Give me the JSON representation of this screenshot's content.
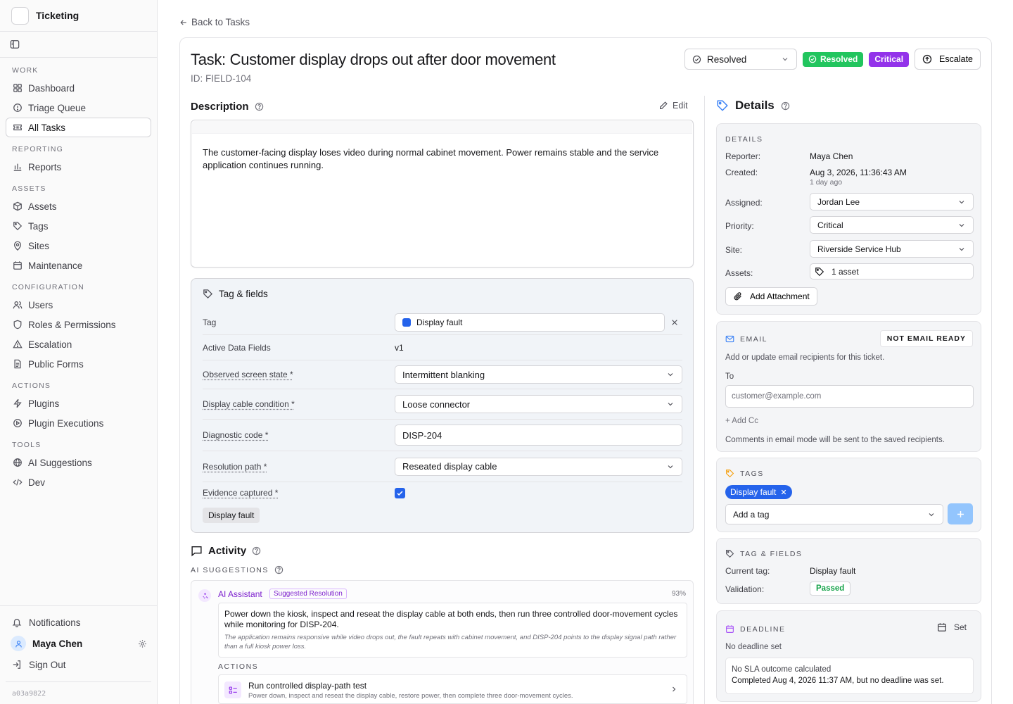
{
  "app": {
    "name": "Ticketing",
    "build": "a03a9822"
  },
  "sidebar": {
    "sections": [
      {
        "label": "WORK",
        "items": [
          {
            "label": "Dashboard",
            "icon": "grid-icon"
          },
          {
            "label": "Triage Queue",
            "icon": "alert-circle-icon"
          },
          {
            "label": "All Tasks",
            "icon": "ticket-icon",
            "active": true
          }
        ]
      },
      {
        "label": "REPORTING",
        "items": [
          {
            "label": "Reports",
            "icon": "bar-chart-icon"
          }
        ]
      },
      {
        "label": "ASSETS",
        "items": [
          {
            "label": "Assets",
            "icon": "box-icon"
          },
          {
            "label": "Tags",
            "icon": "tag-icon"
          },
          {
            "label": "Sites",
            "icon": "map-pin-icon"
          },
          {
            "label": "Maintenance",
            "icon": "calendar-icon"
          }
        ]
      },
      {
        "label": "CONFIGURATION",
        "items": [
          {
            "label": "Users",
            "icon": "users-icon"
          },
          {
            "label": "Roles & Permissions",
            "icon": "shield-icon"
          },
          {
            "label": "Escalation",
            "icon": "warning-triangle-icon"
          },
          {
            "label": "Public Forms",
            "icon": "file-text-icon"
          }
        ]
      },
      {
        "label": "ACTIONS",
        "items": [
          {
            "label": "Plugins",
            "icon": "zap-icon"
          },
          {
            "label": "Plugin Executions",
            "icon": "play-circle-icon"
          }
        ]
      },
      {
        "label": "TOOLS",
        "items": [
          {
            "label": "AI Suggestions",
            "icon": "globe-icon"
          },
          {
            "label": "Dev",
            "icon": "code-icon"
          }
        ]
      }
    ],
    "notifications": "Notifications",
    "user_name": "Maya Chen",
    "sign_out": "Sign Out"
  },
  "header": {
    "back": "Back to Tasks",
    "title": "Task: Customer display drops out after door movement",
    "id": "ID: FIELD-104",
    "status_value": "Resolved",
    "badge_status": "Resolved",
    "badge_priority": "Critical",
    "escalate": "Escalate",
    "colors": {
      "resolved": "#22c55e",
      "critical": "#9333ea"
    }
  },
  "description": {
    "title": "Description",
    "edit": "Edit",
    "text": "The customer-facing display loses video during normal cabinet movement. Power remains stable and the service application continues running."
  },
  "tag_fields": {
    "title": "Tag & fields",
    "tag_label": "Tag",
    "tag_value": "Display fault",
    "active_label": "Active Data Fields",
    "active_value": "v1",
    "fields": [
      {
        "label": "Observed screen state *",
        "value": "Intermittent blanking",
        "type": "select"
      },
      {
        "label": "Display cable condition *",
        "value": "Loose connector",
        "type": "select"
      },
      {
        "label": "Diagnostic code *",
        "value": "DISP-204",
        "type": "text"
      },
      {
        "label": "Resolution path *",
        "value": "Reseated display cable",
        "type": "select"
      }
    ],
    "evidence_label": "Evidence captured *",
    "evidence_checked": true,
    "chip": "Display fault"
  },
  "activity": {
    "title": "Activity",
    "ai_label": "AI SUGGESTIONS",
    "assistant": "AI Assistant",
    "badge": "Suggested Resolution",
    "confidence": "93%",
    "suggestion": "Power down the kiosk, inspect and reseat the display cable at both ends, then run three controlled door-movement cycles while monitoring for DISP-204.",
    "reason": "The application remains responsive while video drops out, the fault repeats with cabinet movement, and DISP-204 points to the display signal path rather than a full kiosk power loss.",
    "actions_label": "ACTIONS",
    "action_title": "Run controlled display-path test",
    "action_desc": "Power down, inspect and reseat the display cable, restore power, then complete three door-movement cycles."
  },
  "details": {
    "title": "Details",
    "section_label": "DETAILS",
    "reporter_k": "Reporter:",
    "reporter_v": "Maya Chen",
    "created_k": "Created:",
    "created_v": "Aug 3, 2026, 11:36:43 AM",
    "created_sub": "1 day ago",
    "assigned_k": "Assigned:",
    "assigned_v": "Jordan Lee",
    "priority_k": "Priority:",
    "priority_v": "Critical",
    "site_k": "Site:",
    "site_v": "Riverside Service Hub",
    "assets_k": "Assets:",
    "assets_v": "1 asset",
    "attach": "Add Attachment"
  },
  "email": {
    "label": "EMAIL",
    "status": "NOT EMAIL READY",
    "help": "Add or update email recipients for this ticket.",
    "to_label": "To",
    "placeholder": "customer@example.com",
    "add_cc": "+ Add Cc",
    "note": "Comments in email mode will be sent to the saved recipients."
  },
  "tags": {
    "label": "TAGS",
    "chip": "Display fault",
    "add_placeholder": "Add a tag"
  },
  "tag_summary": {
    "label": "TAG & FIELDS",
    "current_k": "Current tag:",
    "current_v": "Display fault",
    "validation_k": "Validation:",
    "validation_v": "Passed"
  },
  "deadline": {
    "label": "DEADLINE",
    "set": "Set",
    "none": "No deadline set",
    "sla_title": "No SLA outcome calculated",
    "sla_detail": "Completed Aug 4, 2026 11:37 AM, but no deadline was set."
  }
}
